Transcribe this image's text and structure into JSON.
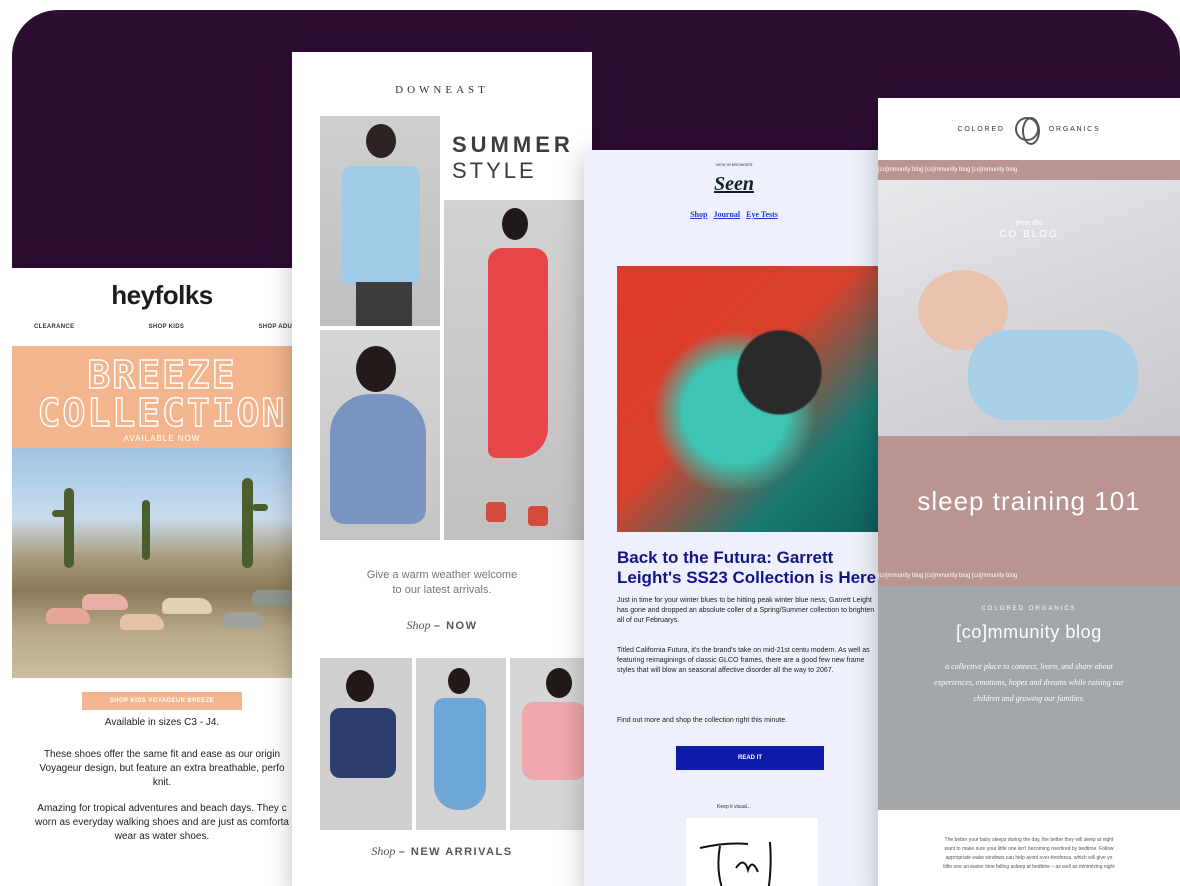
{
  "heyfolks": {
    "logo": "heyfolks",
    "nav": [
      "CLEARANCE",
      "SHOP KIDS",
      "SHOP ADULTS"
    ],
    "hero_title_1": "BREEZE",
    "hero_title_2": "COLLECTION",
    "hero_sub": "AVAILABLE NOW",
    "cta": "SHOP KIDS VOYAGEUR BREEZE",
    "sizes": "Available in sizes C3 - J4.",
    "para1_l1": "These shoes offer the same fit and ease as our origin",
    "para1_l2": "Voyageur design, but feature an extra breathable, perfo",
    "para1_l3": "knit.",
    "para2_l1": "Amazing for tropical adventures and beach days. They c",
    "para2_l2": "worn as everyday walking shoes and are just as comforta",
    "para2_l3": "wear as water shoes."
  },
  "downeast": {
    "logo": "DOWNEAST",
    "title_1": "SUMMER",
    "title_2": "STYLE",
    "blurb_1": "Give a warm weather welcome",
    "blurb_2": "to our latest arrivals.",
    "shop_italic": "Shop",
    "shop_now": "– NOW",
    "shop_italic_2": "Shop",
    "shop_new": "– NEW ARRIVALS"
  },
  "seen": {
    "top_link": "VIEW IN BROWSER",
    "logo": "Seen",
    "nav": [
      "Shop",
      "Journal",
      "Eye Tests"
    ],
    "headline": "Back to the Futura: Garrett Leight's SS23 Collection is Here",
    "p1": "Just in time for your winter blues to be hitting peak winter blue ness, Garrett Leight has gone and dropped an absolute coller of a Spring/Summer collection to brighten all of our Februarys.",
    "p2": "Titled California Futura, it's the brand's take on mid-21st centu modern. As well as featuring reimaginings of classic GLCO frames, there are a good few new frame styles that will blow an seasonal affective disorder all the way to 2067.",
    "p3": "Find out more and shop the collection right this minute.",
    "button": "READ IT",
    "keep": "Keep it visual..."
  },
  "organics": {
    "brand_left": "COLORED",
    "brand_right": "ORGANICS",
    "strip": "[co]mmunity blog     [co]mmunity blog     [co]mmunity blog",
    "photo_kicker": "from the",
    "photo_title": "CO BLOG",
    "pink_title": "sleep training 101",
    "grey_kicker": "COLORED ORGANICS",
    "grey_title": "[co]mmunity blog",
    "grey_desc": "a collective place to connect, learn, and share about experiences, emotions, hopes and dreams while raising our children and growing our families.",
    "body_l1": "The better your baby sleeps during the day, the better they will sleep at night",
    "body_l2": "want to make sure your little one isn't becoming overtired by bedtime. Follow",
    "body_l3": "appropriate wake windows can help avoid over-tiredness, which will give yo",
    "body_l4": "little one an easier time falling asleep at bedtime – as well as minimizing night"
  },
  "colors": {
    "backdrop": "#2e0d33",
    "heyfolks_peach": "#f2b58d",
    "seen_blue": "#0c1aa7",
    "organics_rose": "#b99490",
    "organics_grey": "#a3a6ab"
  }
}
